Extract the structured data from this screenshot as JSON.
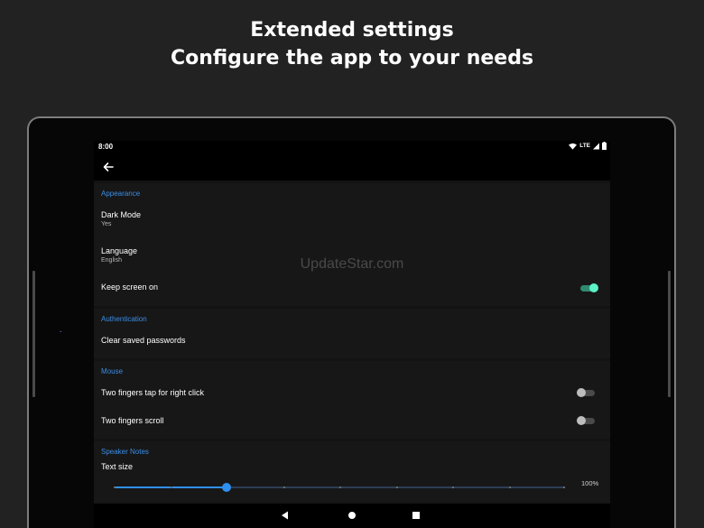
{
  "promo": {
    "line1": "Extended settings",
    "line2": "Configure the app to your needs"
  },
  "status_bar": {
    "time": "8:00",
    "network": "LTE",
    "icons": [
      "wifi-icon",
      "signal-icon",
      "battery-icon"
    ]
  },
  "app_bar": {
    "back_icon": "arrow-back-icon"
  },
  "sections": {
    "appearance": {
      "header": "Appearance",
      "dark_mode": {
        "title": "Dark Mode",
        "value": "Yes"
      },
      "language": {
        "title": "Language",
        "value": "English"
      },
      "keep_screen_on": {
        "title": "Keep screen on",
        "enabled": true
      }
    },
    "authentication": {
      "header": "Authentication",
      "clear_passwords": {
        "title": "Clear saved passwords"
      }
    },
    "mouse": {
      "header": "Mouse",
      "two_finger_tap": {
        "title": "Two fingers tap for right click",
        "enabled": false
      },
      "two_finger_scroll": {
        "title": "Two fingers scroll",
        "enabled": false
      }
    },
    "speaker_notes": {
      "header": "Speaker Notes",
      "text_size": {
        "title": "Text size",
        "value_label": "100%",
        "fraction": 0.25,
        "steps": 8
      }
    }
  },
  "nav_bar": {
    "icons": [
      "back-triangle-icon",
      "home-circle-icon",
      "recents-square-icon"
    ]
  },
  "watermark": "UpdateStar.com",
  "colors": {
    "background": "#222222",
    "accent_blue": "#3a8ee6",
    "toggle_on": "#5ef0c6",
    "slider": "#2f8ff0"
  }
}
